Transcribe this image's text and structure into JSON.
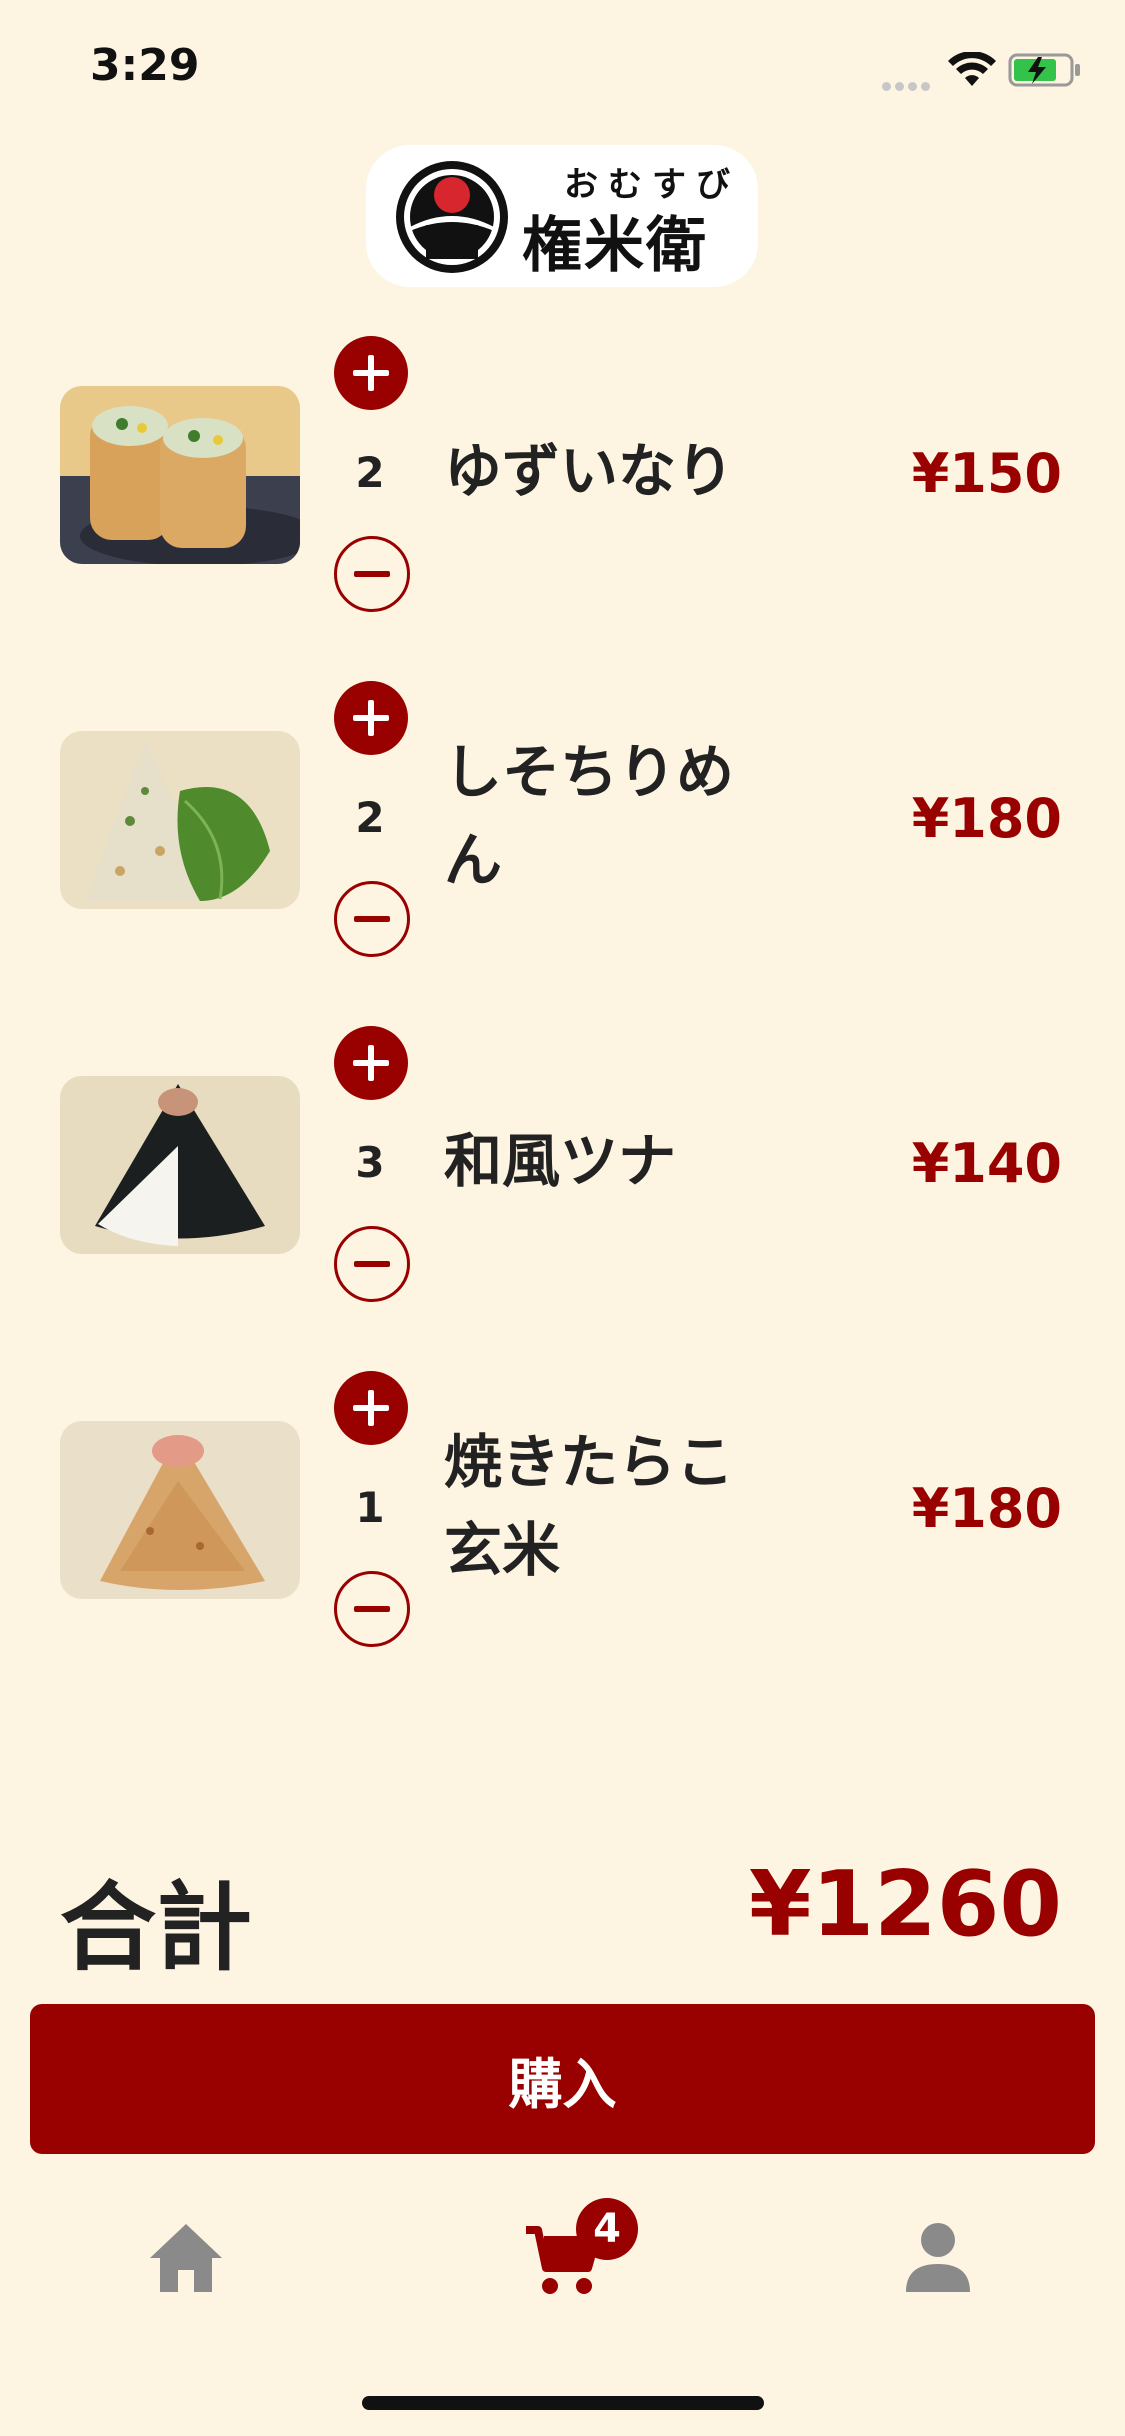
{
  "status": {
    "time": "3:29"
  },
  "logo": {
    "kana": "おむすび",
    "name": "権米衛"
  },
  "colors": {
    "accent": "#990000",
    "background": "#fdf4e1",
    "text": "#222222"
  },
  "cart": {
    "items": [
      {
        "name": "ゆずいなり",
        "quantity": "2",
        "price": "¥150",
        "image": "inari-photo"
      },
      {
        "name": "しそちりめん",
        "quantity": "2",
        "price": "¥180",
        "image": "shiso-onigiri-photo"
      },
      {
        "name": "和風ツナ",
        "quantity": "3",
        "price": "¥140",
        "image": "tuna-onigiri-photo"
      },
      {
        "name": "焼きたらこ玄米",
        "quantity": "1",
        "price": "¥180",
        "image": "tarako-onigiri-photo"
      }
    ],
    "total_label": "合計",
    "total_value": "¥1260",
    "purchase_label": "購入"
  },
  "tabbar": {
    "items": [
      {
        "name": "home",
        "icon": "home-icon"
      },
      {
        "name": "cart",
        "icon": "cart-icon",
        "badge": "4"
      },
      {
        "name": "profile",
        "icon": "person-icon"
      }
    ]
  }
}
